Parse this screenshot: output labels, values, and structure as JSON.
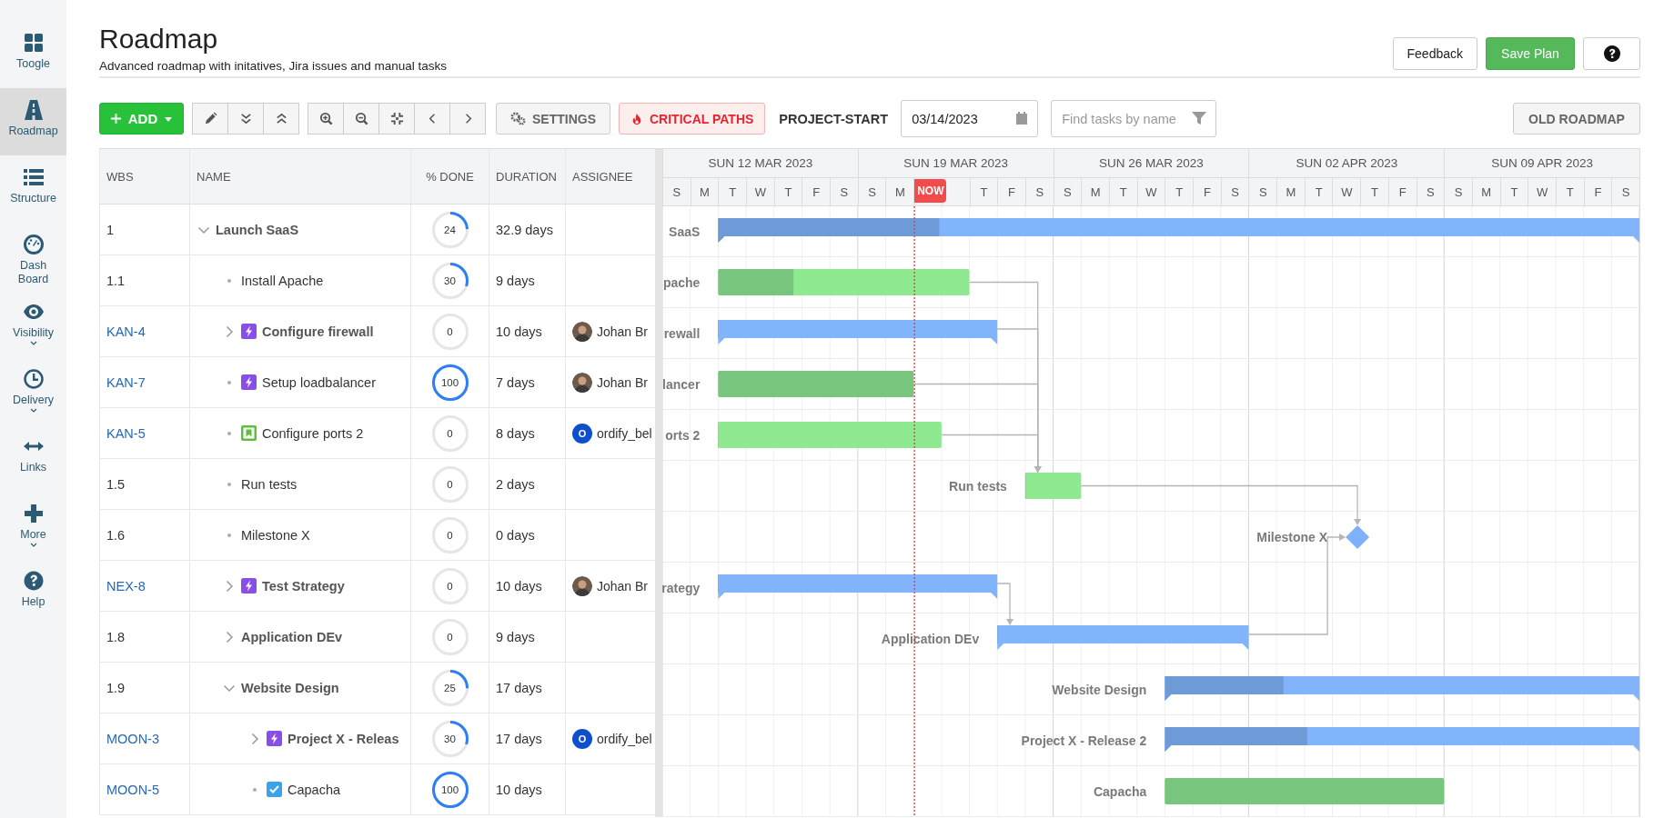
{
  "sidebar": {
    "items": [
      {
        "label": "Toogle",
        "selected": false,
        "has_menu": false
      },
      {
        "label": "Roadmap",
        "selected": true,
        "has_menu": false
      },
      {
        "label": "Structure",
        "selected": false,
        "has_menu": false
      },
      {
        "label": "Dash Board",
        "selected": false,
        "has_menu": false
      },
      {
        "label": "Visibility",
        "selected": false,
        "has_menu": true
      },
      {
        "label": "Delivery",
        "selected": false,
        "has_menu": true
      },
      {
        "label": "Links",
        "selected": false,
        "has_menu": false
      },
      {
        "label": "More",
        "selected": false,
        "has_menu": true
      },
      {
        "label": "Help",
        "selected": false,
        "has_menu": false
      }
    ]
  },
  "header": {
    "title": "Roadmap",
    "subtitle": "Advanced roadmap with initatives, Jira issues and manual tasks",
    "buttons": [
      {
        "kind": "outline",
        "label": "Feedback"
      },
      {
        "kind": "primary",
        "label": "Save Plan"
      },
      {
        "kind": "help"
      }
    ]
  },
  "toolbar": {
    "add": {
      "label": "ADD"
    },
    "settings": {
      "label": "SETTINGS"
    },
    "critical_paths": {
      "label": "CRITICAL PATHS"
    },
    "project_start": {
      "label": "PROJECT-START",
      "value": "03/14/2023"
    },
    "search": {
      "placeholder": "Find tasks by name"
    },
    "old_roadmap": {
      "label": "OLD ROADMAP"
    }
  },
  "table": {
    "columns": [
      "WBS",
      "NAME",
      "% DONE",
      "DURATION",
      "ASSIGNEE"
    ],
    "rows": [
      {
        "wbs": "1",
        "name": "Launch SaaS",
        "expanded": true,
        "done": "24",
        "level": 0.24,
        "duration": "32.9 days",
        "bar": {
          "kind": "summary",
          "label": "SaaS"
        },
        "children": [
          {
            "wbs": "1.1",
            "name": "Install Apache",
            "done": "30",
            "level": 0.3,
            "duration": "9 days",
            "bar": {
              "kind": "task",
              "label": "pache"
            }
          },
          {
            "wbs": "KAN-4",
            "kind": "epic",
            "name": "Configure firewall",
            "expanded": false,
            "done": "0",
            "level": 0,
            "duration": "10 days",
            "assignee": {
              "kind": "photo",
              "name": "Johan Br"
            },
            "bar": {
              "kind": "summary",
              "label": "rewall"
            }
          },
          {
            "wbs": "KAN-7",
            "kind": "epic",
            "name": "Setup loadbalancer",
            "done": "100",
            "level": 1,
            "duration": "7 days",
            "assignee": {
              "kind": "photo",
              "name": "Johan Br"
            },
            "bar": {
              "kind": "task",
              "label": "lancer"
            }
          },
          {
            "wbs": "KAN-5",
            "kind": "story",
            "name": "Configure ports 2",
            "done": "0",
            "level": 0,
            "duration": "8 days",
            "assignee": {
              "kind": "initial",
              "initial": "O",
              "name": "ordify_bel"
            },
            "bar": {
              "kind": "task",
              "label": "orts 2"
            }
          },
          {
            "wbs": "1.5",
            "name": "Run tests",
            "done": "0",
            "level": 0,
            "duration": "2 days",
            "bar": {
              "kind": "task",
              "label": "Run tests"
            }
          },
          {
            "wbs": "1.6",
            "name": "Milestone X",
            "done": "0",
            "level": 0,
            "duration": "0 days",
            "bar": {
              "kind": "milestone",
              "label": "Milestone X"
            }
          },
          {
            "wbs": "NEX-8",
            "kind": "epic",
            "name": "Test Strategy",
            "expanded": false,
            "done": "0",
            "level": 0,
            "duration": "10 days",
            "assignee": {
              "kind": "photo",
              "name": "Johan Br"
            },
            "bar": {
              "kind": "summary",
              "label": "rategy"
            }
          },
          {
            "wbs": "1.8",
            "name": "Application DEv",
            "expanded": false,
            "done": "0",
            "level": 0,
            "duration": "9 days",
            "bar": {
              "kind": "summary",
              "label": "Application DEv"
            }
          },
          {
            "wbs": "1.9",
            "name": "Website Design",
            "expanded": true,
            "done": "25",
            "level": 0.25,
            "duration": "17 days",
            "bar": {
              "kind": "summary",
              "label": "Website Design"
            },
            "children": [
              {
                "wbs": "MOON-3",
                "kind": "epic",
                "name": "Project X - Releas",
                "expanded": false,
                "done": "30",
                "level": 0.3,
                "duration": "17 days",
                "assignee": {
                  "kind": "initial",
                  "initial": "O",
                  "name": "ordify_bel"
                },
                "bar": {
                  "kind": "summary",
                  "label": "Project X - Release 2"
                }
              },
              {
                "wbs": "MOON-5",
                "kind": "task",
                "name": "Capacha",
                "done": "100",
                "level": 1,
                "duration": "10 days",
                "bar": {
                  "kind": "task",
                  "label": "Capacha"
                }
              }
            ]
          }
        ]
      }
    ]
  },
  "gantt": {
    "weeks": [
      {
        "label": "SUN 12 MAR 2023",
        "days": [
          "S",
          "M",
          "T",
          "W",
          "T",
          "F",
          "S"
        ]
      },
      {
        "label": "SUN 19 MAR 2023",
        "days": [
          "S",
          "M",
          "T",
          "F",
          "S"
        ]
      },
      {
        "label": "SUN 26 MAR 2023",
        "days": [
          "S",
          "M",
          "T",
          "W",
          "T",
          "F",
          "S"
        ]
      },
      {
        "label": "SUN 02 APR 2023",
        "days": [
          "S",
          "M",
          "T",
          "W",
          "T",
          "F",
          "S"
        ]
      },
      {
        "label": "SUN 09 APR 2023",
        "days": [
          "S",
          "M",
          "T",
          "W",
          "T",
          "F",
          "S"
        ]
      }
    ],
    "now": {
      "label": "NOW"
    }
  }
}
